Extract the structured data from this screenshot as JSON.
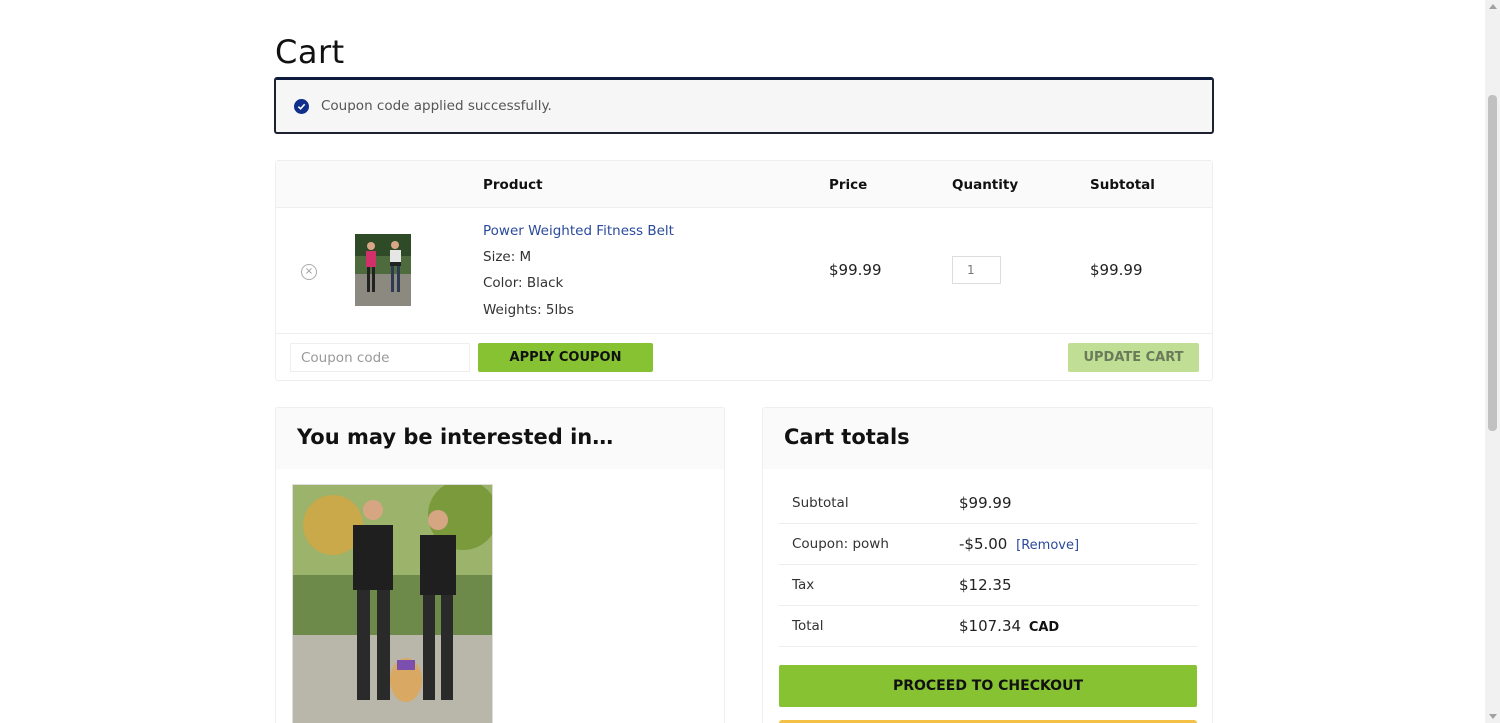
{
  "page": {
    "title": "Cart"
  },
  "notice": {
    "message": "Coupon code applied successfully."
  },
  "cart_table": {
    "headers": {
      "product": "Product",
      "price": "Price",
      "quantity": "Quantity",
      "subtotal": "Subtotal"
    },
    "item": {
      "remove_symbol": "×",
      "name": "Power Weighted Fitness Belt",
      "size": "Size: M",
      "color": "Color: Black",
      "weights": "Weights: 5lbs",
      "price": "$99.99",
      "quantity": "1",
      "subtotal": "$99.99"
    },
    "coupon_placeholder": "Coupon code",
    "apply_label": "APPLY COUPON",
    "update_label": "UPDATE CART"
  },
  "upsell": {
    "heading": "You may be interested in…"
  },
  "totals": {
    "heading": "Cart totals",
    "subtotal_label": "Subtotal",
    "subtotal_value": "$99.99",
    "coupon_label": "Coupon: powh",
    "coupon_value": "-$5.00",
    "coupon_remove": "[Remove]",
    "tax_label": "Tax",
    "tax_value": "$12.35",
    "total_label": "Total",
    "total_value": "$107.34",
    "total_currency": "CAD",
    "checkout_label": "PROCEED TO CHECKOUT"
  },
  "colors": {
    "accent_green": "#86c232",
    "link_blue": "#2b4a9c",
    "notice_icon": "#0f2f8a"
  }
}
